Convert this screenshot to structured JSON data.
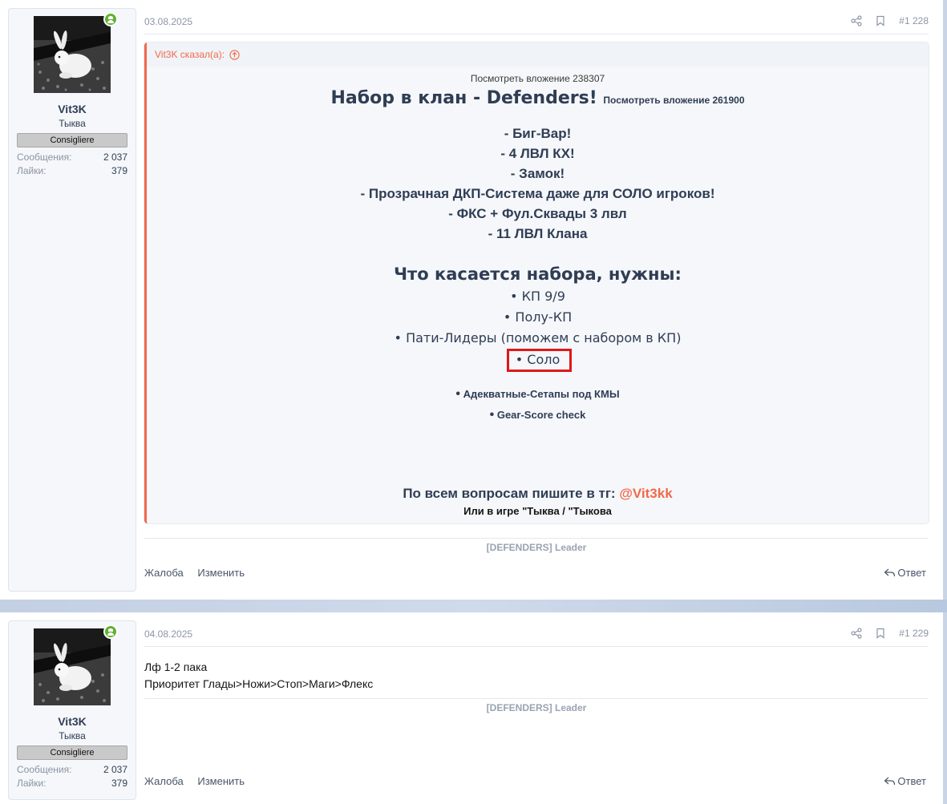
{
  "posts": [
    {
      "user": {
        "name": "Vit3K",
        "title": "Тыква",
        "banner": "Consigliere",
        "stats": [
          {
            "label": "Сообщения:",
            "value": "2 037"
          },
          {
            "label": "Лайки:",
            "value": "379"
          }
        ],
        "online": true
      },
      "date": "03.08.2025",
      "number": "#1 228",
      "quote": {
        "author_line": "Vit3K сказал(а):",
        "attachment_top": "Посмотреть вложение 238307",
        "title": "Набор в клан - Defenders!",
        "title_attachment": "Посмотреть вложение 261900",
        "features": [
          "- Биг-Вар!",
          "- 4 ЛВЛ КХ!",
          "- Замок!",
          "- Прозрачная ДКП-Система даже для СОЛО игроков!",
          "- ФКС + Фул.Сквады 3 лвл",
          "- 11 ЛВЛ Клана"
        ],
        "need_title": "Что касается набора, нужны:",
        "needs": [
          "• КП 9/9",
          "• Полу-КП",
          "• Пати-Лидеры (поможем с набором в КП)",
          "• Соло"
        ],
        "extras": [
          "Адекватные-Сетапы под КМЫ",
          "Gear-Score check"
        ],
        "bullet": "•",
        "contact_text": "По всем вопросам пишите в тг: ",
        "contact_handle": "@Vit3kk",
        "contact_game": "Или в игре \"Тыква / \"Тыкова"
      },
      "signature": "[DEFENDERS] Leader",
      "actions": {
        "report": "Жалоба",
        "edit": "Изменить",
        "reply": "Ответ"
      }
    },
    {
      "user": {
        "name": "Vit3K",
        "title": "Тыква",
        "banner": "Consigliere",
        "stats": [
          {
            "label": "Сообщения:",
            "value": "2 037"
          },
          {
            "label": "Лайки:",
            "value": "379"
          }
        ],
        "online": true
      },
      "date": "04.08.2025",
      "number": "#1 229",
      "body": [
        "Лф 1-2 пака",
        "Приоритет Глады>Ножи>Стоп>Маги>Флекс"
      ],
      "signature": "[DEFENDERS] Leader",
      "actions": {
        "report": "Жалоба",
        "edit": "Изменить",
        "reply": "Ответ"
      }
    }
  ],
  "colors": {
    "accent": "#f2694b",
    "online": "#63b132",
    "highlight_box": "#e01818",
    "text_dark": "#2f3d54",
    "muted": "#8c95a5"
  }
}
